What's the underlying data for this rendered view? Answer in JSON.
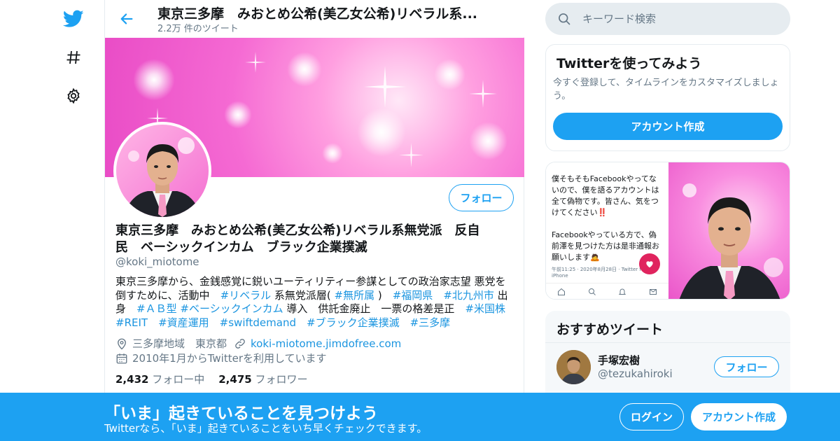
{
  "nav": {
    "icons": [
      "twitter-bird-icon",
      "hashtag-icon",
      "gear-icon"
    ]
  },
  "header": {
    "title": "東京三多摩　みおとめ公希(美乙女公希)リベラル系...",
    "tweet_count": "2.2万 件のツイート"
  },
  "profile": {
    "follow_label": "フォロー",
    "name_line1": "東京三多摩　みおとめ公希(美乙女公希)リベラル系無党派　反自",
    "name_line2": "民　ベーシックインカム　ブラック企業撲滅",
    "handle": "@koki_miotome",
    "bio": {
      "p1": "東京三多摩から、金銭感覚に鋭いユーティリティー参謀としての政治家志望 悪党を倒すために、活動中　",
      "t1": "#リベラル",
      "p2": " 系無党派層( ",
      "t2": "#無所属",
      "p3": " )　",
      "t3": "#福岡県",
      "p4": "　",
      "t4": "#北九州市",
      "p5": " 出身　",
      "t5": "#ＡＢ型",
      "p6": " ",
      "t6": "#ベーシックインカム",
      "p7": " 導入　供託金廃止　一票の格差是正　",
      "t7": "#米国株",
      "p8": "　",
      "t8": "#REIT",
      "p9": "　",
      "t9": "#資産運用",
      "p10": "　",
      "t10": "#swiftdemand",
      "p11": "　",
      "t11": "#ブラック企業撲滅",
      "p12": "　",
      "t12": "#三多摩"
    },
    "location": "三多摩地域　東京都",
    "website": "koki-miotome.jimdofree.com",
    "joined": "2010年1月からTwitterを利用しています",
    "following_count": "2,432",
    "following_label": "フォロー中",
    "followers_count": "2,475",
    "followers_label": "フォロワー"
  },
  "search": {
    "placeholder": "キーワード検索"
  },
  "signup_card": {
    "title": "Twitterを使ってみよう",
    "description": "今すぐ登録して、タイムラインをカスタマイズしましょう。",
    "button": "アカウント作成"
  },
  "media_card": {
    "text1": "僕そもそもFacebookやってないので、僕を語るアカウントは全て偽物です。皆さん、気をつけてください‼️",
    "text2": "Facebookやっている方で、偽前澤を見つけた方は是非通報お願いします🙇",
    "meta": "午前11:25 · 2020年8月28日 · Twitter for iPhone"
  },
  "recommended": {
    "title": "おすすめツイート",
    "user_name": "手塚宏樹",
    "user_handle": "@tezukahiroki",
    "follow_label": "フォロー"
  },
  "bottom_bar": {
    "title": "「いま」起きていることを見つけよう",
    "subtitle": "Twitterなら、「いま」起きていることをいち早くチェックできます。",
    "login": "ログイン",
    "signup": "アカウント作成"
  },
  "colors": {
    "accent": "#1da1f2",
    "link": "#1b95e0",
    "muted": "#657786",
    "banner_pink": "#f56ad3"
  }
}
